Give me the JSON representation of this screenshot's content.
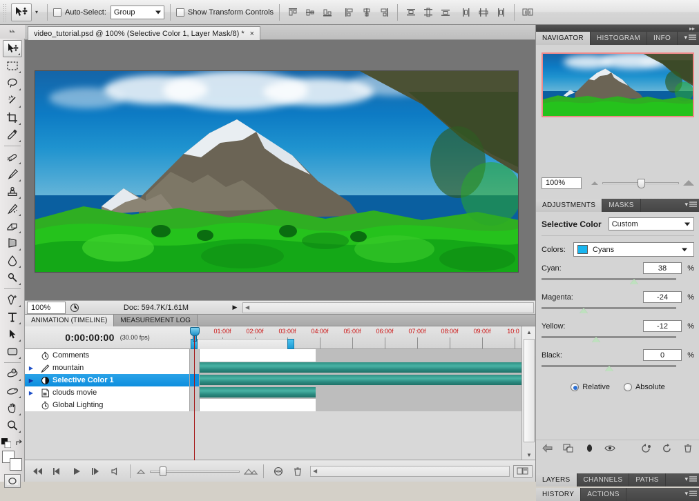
{
  "app": {
    "document_tab": "video_tutorial.psd @ 100% (Selective Color 1, Layer Mask/8) *",
    "close_glyph": "×"
  },
  "options_bar": {
    "auto_select_label": "Auto-Select:",
    "auto_select_value": "Group",
    "show_transform_label": "Show Transform Controls",
    "align_icons": [
      "align-top-edges-icon",
      "align-vertical-centers-icon",
      "align-bottom-edges-icon",
      "align-left-edges-icon",
      "align-horizontal-centers-icon",
      "align-right-edges-icon",
      "distribute-top-edges-icon",
      "distribute-vertical-centers-icon",
      "distribute-bottom-edges-icon",
      "distribute-left-edges-icon",
      "distribute-horizontal-centers-icon",
      "distribute-right-edges-icon",
      "auto-align-layers-icon"
    ]
  },
  "toolbar": {
    "tools": [
      {
        "name": "move-tool",
        "selected": true
      },
      {
        "name": "rectangular-marquee-tool",
        "selected": false
      },
      {
        "name": "lasso-tool",
        "selected": false
      },
      {
        "name": "magic-wand-tool",
        "selected": false
      },
      {
        "name": "crop-tool",
        "selected": false
      },
      {
        "name": "eyedropper-tool",
        "selected": false
      },
      {
        "name": "spot-healing-brush-tool",
        "selected": false
      },
      {
        "name": "brush-tool",
        "selected": false
      },
      {
        "name": "clone-stamp-tool",
        "selected": false
      },
      {
        "name": "history-brush-tool",
        "selected": false
      },
      {
        "name": "eraser-tool",
        "selected": false
      },
      {
        "name": "gradient-tool",
        "selected": false
      },
      {
        "name": "blur-tool",
        "selected": false
      },
      {
        "name": "dodge-tool",
        "selected": false
      },
      {
        "name": "pen-tool",
        "selected": false
      },
      {
        "name": "horizontal-type-tool",
        "selected": false
      },
      {
        "name": "path-selection-tool",
        "selected": false
      },
      {
        "name": "rounded-rectangle-tool",
        "selected": false
      },
      {
        "name": "3d-rotate-tool",
        "selected": false
      },
      {
        "name": "3d-orbit-tool",
        "selected": false
      },
      {
        "name": "hand-tool",
        "selected": false
      },
      {
        "name": "zoom-tool",
        "selected": false
      }
    ],
    "foreground_color": "#ffffff",
    "background_color": "#ffffff"
  },
  "status_bar": {
    "zoom": "100%",
    "doc_info": "Doc: 594.7K/1.61M"
  },
  "animation": {
    "tabs": [
      {
        "label": "ANIMATION (TIMELINE)",
        "active": true
      },
      {
        "label": "MEASUREMENT LOG",
        "active": false
      }
    ],
    "current_time": "0:00:00:00",
    "frame_rate": "(30.00 fps)",
    "ruler_labels": [
      "01:00f",
      "02:00f",
      "03:00f",
      "04:00f",
      "05:00f",
      "06:00f",
      "07:00f",
      "08:00f",
      "09:00f",
      "10:0"
    ],
    "tracks": [
      {
        "name": "Comments",
        "icon": "stopwatch-icon",
        "has_disclosure": false,
        "selected": false,
        "bar": "none",
        "bar_end_pct": 0,
        "white_end_pct": 36
      },
      {
        "name": "mountain",
        "icon": "brush-layer-icon",
        "has_disclosure": true,
        "selected": false,
        "bar": "full",
        "bar_end_pct": 100,
        "white_end_pct": 0
      },
      {
        "name": "Selective Color 1",
        "icon": "adjustment-layer-icon",
        "has_disclosure": true,
        "selected": true,
        "bar": "full",
        "bar_end_pct": 100,
        "white_end_pct": 0
      },
      {
        "name": "clouds movie",
        "icon": "video-layer-icon",
        "has_disclosure": true,
        "selected": false,
        "bar": "partial",
        "bar_end_pct": 36,
        "white_end_pct": 0
      },
      {
        "name": "Global Lighting",
        "icon": "stopwatch-icon",
        "has_disclosure": false,
        "selected": false,
        "bar": "none",
        "bar_end_pct": 0,
        "white_end_pct": 36
      }
    ]
  },
  "transport": {
    "buttons": [
      "go-to-first-frame-icon",
      "select-previous-frame-icon",
      "play-icon",
      "select-next-frame-icon",
      "audio-mute-icon"
    ],
    "zoom_small_icon": "zoom-out-timeline-icon",
    "zoom_big_icon": "zoom-in-timeline-icon",
    "onion_skins_icon": "onion-skins-icon",
    "delete_icon": "delete-keyframes-icon",
    "convert_icon": "convert-to-frame-animation-icon"
  },
  "navigator": {
    "tabs": [
      {
        "label": "NAVIGATOR",
        "active": true
      },
      {
        "label": "HISTOGRAM",
        "active": false
      },
      {
        "label": "INFO",
        "active": false
      }
    ],
    "zoom_value": "100%",
    "view_box_color": "#f08a8a"
  },
  "adjustments": {
    "tabs": [
      {
        "label": "ADJUSTMENTS",
        "active": true
      },
      {
        "label": "MASKS",
        "active": false
      }
    ],
    "title": "Selective Color",
    "preset": "Custom",
    "colors_label": "Colors:",
    "colors_value": "Cyans",
    "colors_swatch": "#18b5ef",
    "sliders": [
      {
        "label": "Cyan:",
        "value": "38",
        "unit": "%",
        "thumb_pct": 69
      },
      {
        "label": "Magenta:",
        "value": "-24",
        "unit": "%",
        "thumb_pct": 31
      },
      {
        "label": "Yellow:",
        "value": "-12",
        "unit": "%",
        "thumb_pct": 40
      },
      {
        "label": "Black:",
        "value": "0",
        "unit": "%",
        "thumb_pct": 50
      }
    ],
    "method_options": [
      {
        "label": "Relative",
        "selected": true
      },
      {
        "label": "Absolute",
        "selected": false
      }
    ],
    "footer_icons": [
      "return-to-adjustment-list-icon",
      "clip-to-layer-icon",
      "view-previous-state-icon",
      "toggle-layer-visibility-icon",
      "reset-to-previous-icon",
      "reset-adjustment-icon",
      "delete-adjustment-icon"
    ]
  },
  "layers_panel": {
    "tabs": [
      {
        "label": "LAYERS",
        "active": true
      },
      {
        "label": "CHANNELS",
        "active": false
      },
      {
        "label": "PATHS",
        "active": false
      }
    ]
  },
  "history_panel": {
    "tabs": [
      {
        "label": "HISTORY",
        "active": true
      },
      {
        "label": "ACTIONS",
        "active": false
      }
    ]
  }
}
